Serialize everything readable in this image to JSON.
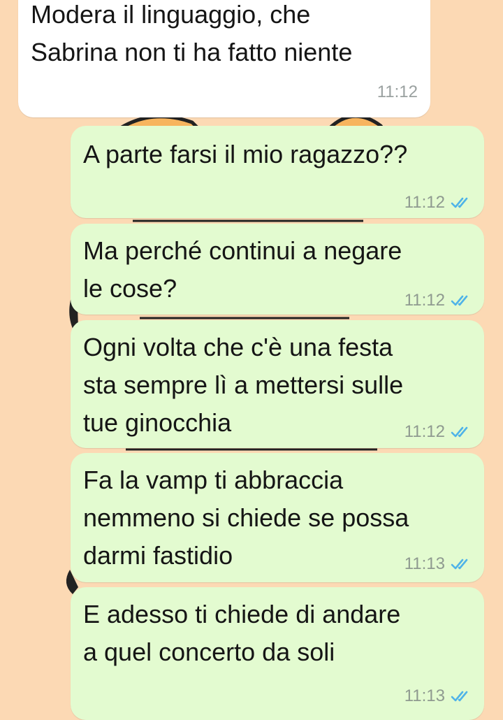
{
  "chat": {
    "messages": [
      {
        "direction": "incoming",
        "text": "Modera il linguaggio, che\nSabrina non ti ha fatto niente",
        "time": "11:12"
      },
      {
        "direction": "outgoing",
        "text": "A parte farsi il mio ragazzo??",
        "time": "11:12",
        "status_icon": "double-check-read-icon"
      },
      {
        "direction": "outgoing",
        "text": "Ma perché continui a negare\nle cose?",
        "time": "11:12",
        "status_icon": "double-check-read-icon"
      },
      {
        "direction": "outgoing",
        "text": "Ogni volta che c'è una festa\nsta sempre lì a mettersi sulle\ntue ginocchia",
        "time": "11:12",
        "status_icon": "double-check-read-icon"
      },
      {
        "direction": "outgoing",
        "text": "Fa la vamp ti abbraccia\nnemmeno si chiede se possa\ndarmi fastidio",
        "time": "11:13",
        "status_icon": "double-check-read-icon"
      },
      {
        "direction": "outgoing",
        "text": "E adesso ti chiede di andare\na quel concerto da soli",
        "time": "11:13",
        "status_icon": "double-check-read-icon"
      }
    ]
  },
  "colors": {
    "wallpaper": "#fcd9b4",
    "incoming_bubble": "#ffffff",
    "outgoing_bubble": "#e3fbd0",
    "read_tick": "#4fb3e8",
    "time_text": "#8f9a90"
  }
}
